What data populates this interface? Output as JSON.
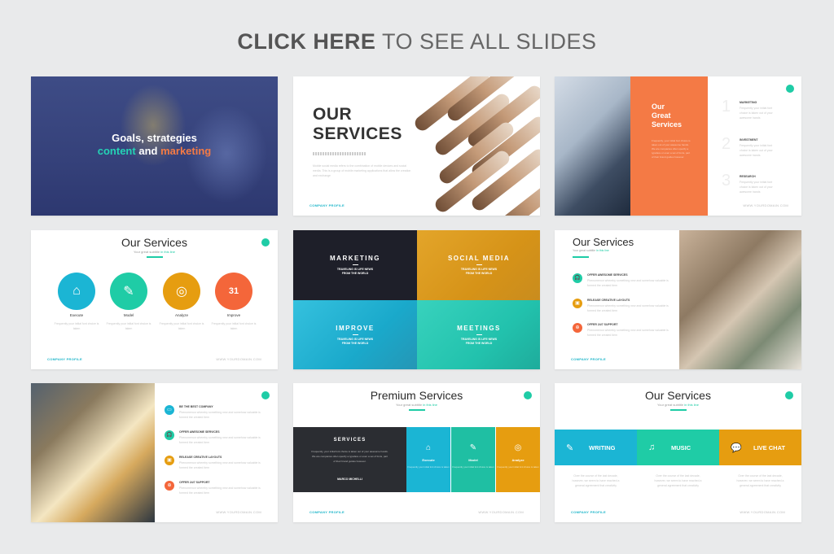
{
  "header": {
    "bold_text": "CLICK HERE",
    "light_text": "TO SEE ALL SLIDES"
  },
  "colors": {
    "teal": "#1fcca6",
    "cyan": "#1bb5d4",
    "orange": "#f47a45",
    "amber": "#e69d10",
    "dark": "#2b2d32",
    "navy": "#35417a"
  },
  "slides": {
    "s1": {
      "line1": "Goals, strategies",
      "word_content": "content",
      "word_and": "and",
      "word_marketing": "marketing"
    },
    "s2": {
      "title_line1": "OUR",
      "title_line2": "SERVICES",
      "description": "Mobile social media refers to the combination of mobile devices and social media. This is a group of mobile marketing applications that allow the creation and exchange",
      "footer": "COMPANY PROFILE"
    },
    "s3": {
      "title_line1": "Our",
      "title_line2": "Great",
      "title_line3": "Services",
      "description": "Frequently, your initial font choice is taken out of your awesome hands. We are companies often specify a typeface or even a set of fonts, part of their brand guides however.",
      "items": [
        {
          "num": "1",
          "heading": "MARKETING",
          "body": "Frequently your initial font choice is taken out of your awesome hands"
        },
        {
          "num": "2",
          "heading": "INVESTMENT",
          "body": "Frequently your initial font choice is taken out of your awesome hands"
        },
        {
          "num": "3",
          "heading": "RESEARCH",
          "body": "Frequently your initial font choice is taken out of your awesome hands"
        }
      ],
      "footer_right": "WWW.YOURDOMAIN.COM"
    },
    "s4": {
      "title": "Our Services",
      "subtitle_a": "Your great subtitle",
      "subtitle_b": "in this line",
      "items": [
        {
          "label": "Execute",
          "icon": "⌂",
          "body": "Frequently your initial font choice is taken"
        },
        {
          "label": "Model",
          "icon": "✎",
          "body": "Frequently your initial font choice is taken"
        },
        {
          "label": "Analyze",
          "icon": "◎",
          "body": "Frequently your initial font choice is taken"
        },
        {
          "label": "Improve",
          "icon": "31",
          "body": "Frequently your initial font choice is taken"
        }
      ],
      "footer_left": "COMPANY PROFILE",
      "footer_right": "WWW.YOURDOMAIN.COM"
    },
    "s5": {
      "quads": [
        {
          "title": "MARKETING",
          "line1": "TRAVELING IS LIFE NEWS",
          "line2": "FROM THE WORLD"
        },
        {
          "title": "SOCIAL MEDIA",
          "line1": "TRAVELING IS LIFE NEWS",
          "line2": "FROM THE WORLD"
        },
        {
          "title": "IMPROVE",
          "line1": "TRAVELING IS LIFE NEWS",
          "line2": "FROM THE WORLD"
        },
        {
          "title": "MEETINGS",
          "line1": "TRAVELING IS LIFE NEWS",
          "line2": "FROM THE WORLD"
        }
      ]
    },
    "s6": {
      "title": "Our Services",
      "subtitle_a": "Your great subtitle",
      "subtitle_b": "in this line",
      "features": [
        {
          "icon": "🎧",
          "heading": "OFFER AWESOME SERVICES",
          "body": "Phenomenon whereby something new and somehow valuable is formed the created item"
        },
        {
          "icon": "▣",
          "heading": "RELEASE CREATIVE LAYOUTS",
          "body": "Phenomenon whereby something new and somehow valuable is formed the created item"
        },
        {
          "icon": "⊕",
          "heading": "OFFER 24/7 SUPPORT",
          "body": "Phenomenon whereby something new and somehow valuable is formed the created item"
        }
      ],
      "footer_left": "COMPANY PROFILE"
    },
    "s7": {
      "features": [
        {
          "icon": "▭",
          "heading": "BE THE BEST COMPANY",
          "body": "Phenomenon whereby something new and somehow valuable is formed the created item"
        },
        {
          "icon": "🎧",
          "heading": "OFFER AWESOME SERVICES",
          "body": "Phenomenon whereby something new and somehow valuable is formed the created item"
        },
        {
          "icon": "▣",
          "heading": "RELEASE CREATIVE LAYOUTS",
          "body": "Phenomenon whereby something new and somehow valuable is formed the created item"
        },
        {
          "icon": "⊕",
          "heading": "OFFER 24/7 SUPPORT",
          "body": "Phenomenon whereby something new and somehow valuable is formed the created item"
        }
      ],
      "footer_right": "WWW.YOURDOMAIN.COM"
    },
    "s8": {
      "title": "Premium Services",
      "subtitle_a": "Your great subtitle",
      "subtitle_b": "in this line",
      "panel_heading": "SERVICES",
      "panel_body": "Frequently, your initial font choice is taken out of your awesome hands. We are companies often specify a typeface or even a set of fonts, part of their brand guides however.",
      "panel_name": "MARCO MICHELLI",
      "cols": [
        {
          "icon": "⌂",
          "label": "Execute",
          "body": "Frequently your initial font choice is taken"
        },
        {
          "icon": "✎",
          "label": "Model",
          "body": "Frequently your initial font choice is taken"
        },
        {
          "icon": "◎",
          "label": "Analyze",
          "body": "Frequently your initial font choice is taken"
        }
      ],
      "footer_left": "COMPANY PROFILE",
      "footer_right": "WWW.YOURDOMAIN.COM"
    },
    "s9": {
      "title": "Our Services",
      "subtitle_a": "Your great subtitle",
      "subtitle_b": "in this line",
      "bands": [
        {
          "icon": "✎",
          "label": "WRITING",
          "body": "Over the course of the last decade, however, we seem to have reached a general agreement that creativity"
        },
        {
          "icon": "♫",
          "label": "MUSIC",
          "body": "Over the course of the last decade, however, we seem to have reached a general agreement that creativity"
        },
        {
          "icon": "💬",
          "label": "LIVE CHAT",
          "body": "Over the course of the last decade, however, we seem to have reached a general agreement that creativity"
        }
      ],
      "footer_left": "COMPANY PROFILE",
      "footer_right": "WWW.YOURDOMAIN.COM"
    }
  }
}
